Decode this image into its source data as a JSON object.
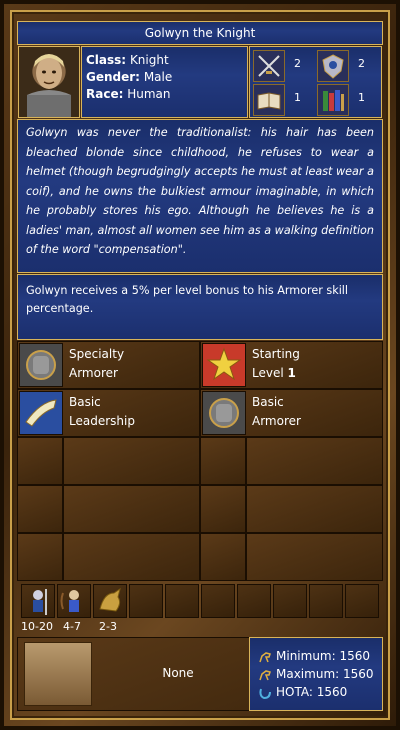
{
  "hero": {
    "title": "Golwyn the Knight",
    "class_label": "Class:",
    "class_value": "Knight",
    "gender_label": "Gender:",
    "gender_value": "Male",
    "race_label": "Race:",
    "race_value": "Human"
  },
  "primary_stats": [
    {
      "icon": "attack-swords-icon",
      "value": "2"
    },
    {
      "icon": "defense-shield-icon",
      "value": "2"
    },
    {
      "icon": "spell-power-book-icon",
      "value": "1"
    },
    {
      "icon": "knowledge-books-icon",
      "value": "1"
    }
  ],
  "biography": "Golwyn was never the traditionalist: his hair has been bleached blonde since childhood, he refuses to wear a helmet (though begrudgingly accepts he must at least wear a coif), and he owns the bulkiest armour imaginable, in which he probably stores his ego. Although he believes he is a ladies' man, almost all women see him as a walking definition of the word \"compensation\".",
  "specialty_description": "Golwyn receives a 5% per level bonus to his Armorer skill percentage.",
  "skills": {
    "specialty": {
      "line1": "Specialty",
      "line2": "Armorer",
      "icon": "armorer-icon"
    },
    "starting_level": {
      "line1": "Starting",
      "line2_prefix": "Level ",
      "line2_value": "1",
      "icon": "level-star-icon"
    },
    "skill1": {
      "line1": "Basic",
      "line2": "Leadership",
      "icon": "leadership-horn-icon"
    },
    "skill2": {
      "line1": "Basic",
      "line2": "Armorer",
      "icon": "armorer-icon"
    }
  },
  "army": [
    {
      "icon": "pikeman-icon",
      "count": "10-20"
    },
    {
      "icon": "archer-icon",
      "count": "4-7"
    },
    {
      "icon": "griffin-icon",
      "count": "2-3"
    }
  ],
  "spellbook": {
    "label": "None",
    "icon": "scroll-icon"
  },
  "movement": {
    "minimum_label": "Minimum:",
    "minimum_value": "1560",
    "maximum_label": "Maximum:",
    "maximum_value": "1560",
    "hota_label": "HOTA:",
    "hota_value": "1560"
  }
}
